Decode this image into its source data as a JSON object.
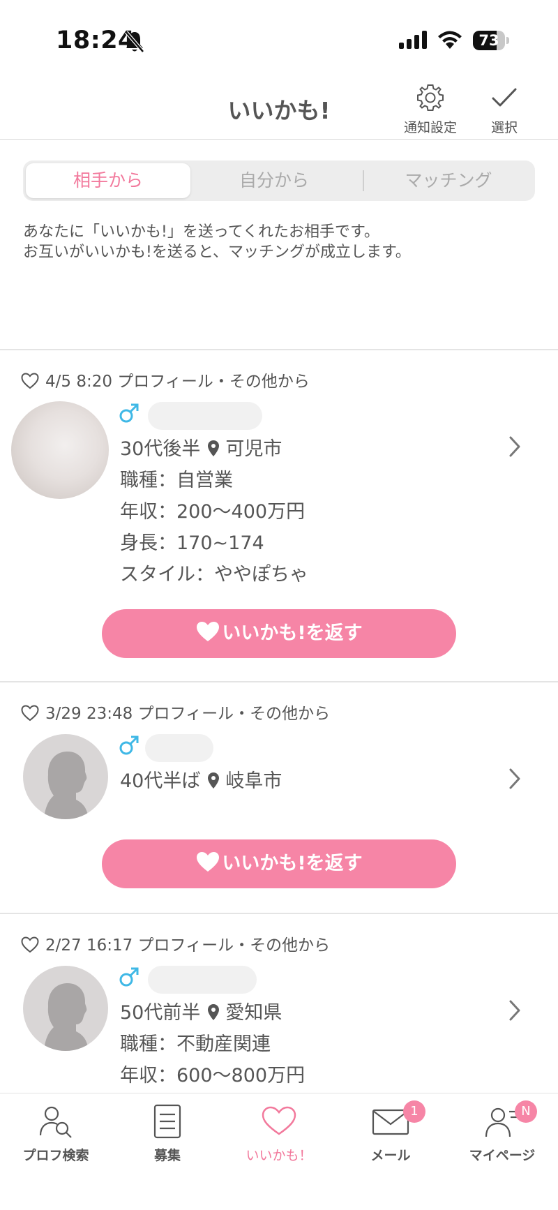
{
  "status_bar": {
    "time": "18:24",
    "battery": "73",
    "battery_level": 0.73
  },
  "header": {
    "title": "いいかも!",
    "notify_label": "通知設定",
    "select_label": "選択"
  },
  "tabs": [
    {
      "label": "相手から",
      "active": true
    },
    {
      "label": "自分から",
      "active": false
    },
    {
      "label": "マッチング",
      "active": false
    }
  ],
  "description": {
    "line1": "あなたに「いいかも!」を送ってくれたお相手です。",
    "line2": "お互いがいいかも!を送ると、マッチングが成立します。"
  },
  "cards": [
    {
      "meta": "4/5 8:20 プロフィール・その他から",
      "age": "30代後半",
      "location": "可児市",
      "job": "職種：自営業",
      "income": "年収：200〜400万円",
      "height": "身長：170~174",
      "style": "スタイル：ややぽちゃ",
      "button": "いいかも!を返す"
    },
    {
      "meta": "3/29 23:48 プロフィール・その他から",
      "age": "40代半ば",
      "location": "岐阜市",
      "button": "いいかも!を返す"
    },
    {
      "meta": "2/27 16:17 プロフィール・その他から",
      "age": "50代前半",
      "location": "愛知県",
      "job": "職種：不動産関連",
      "income": "年収：600〜800万円"
    }
  ],
  "tab_bar": [
    {
      "label": "プロフ検索",
      "icon": "profile-search-icon"
    },
    {
      "label": "募集",
      "icon": "list-icon"
    },
    {
      "label": "いいかも！",
      "icon": "heart-icon",
      "active": true
    },
    {
      "label": "メール",
      "icon": "mail-icon",
      "badge": "1"
    },
    {
      "label": "マイページ",
      "icon": "mypage-icon",
      "badge": "N"
    }
  ],
  "colors": {
    "accent": "#f2799c",
    "button": "#f685a6",
    "gender": "#3fb8e6"
  }
}
